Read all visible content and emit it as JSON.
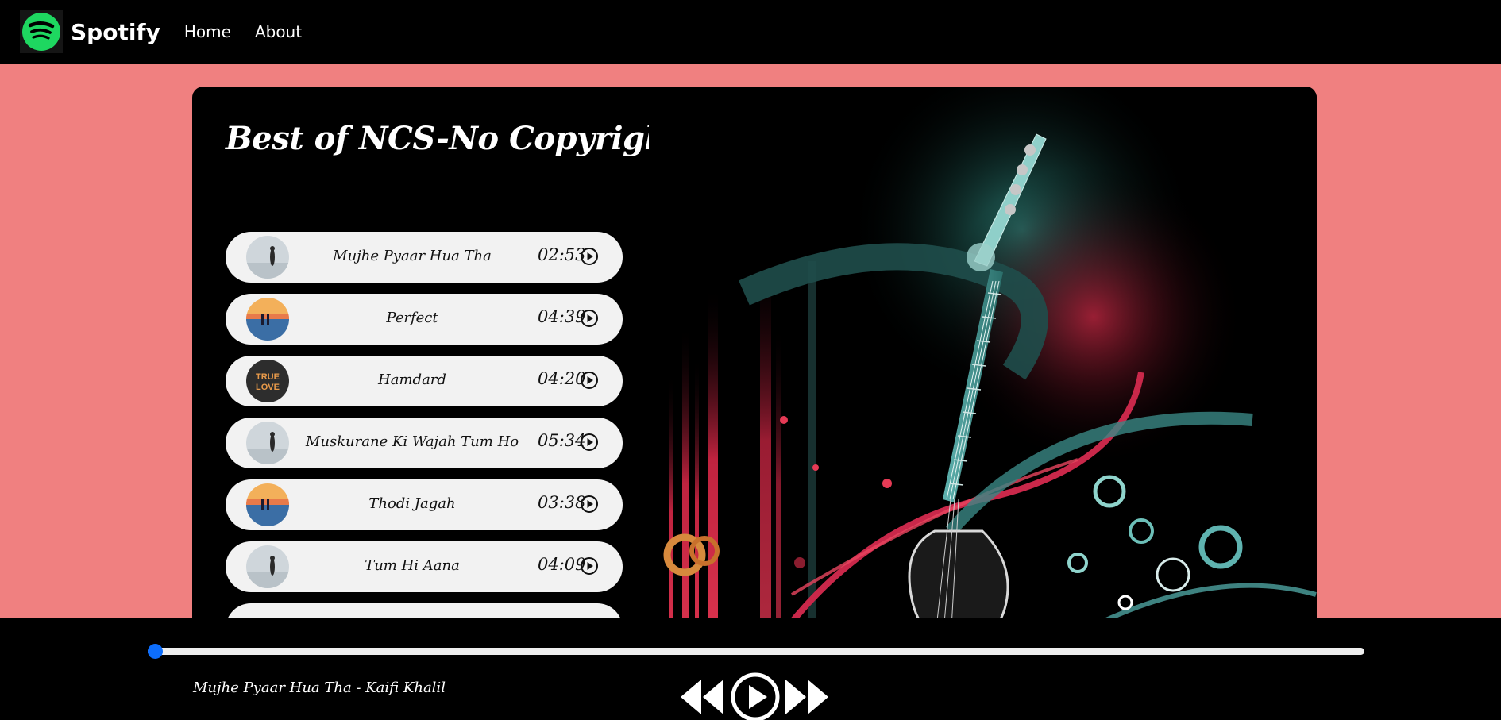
{
  "nav": {
    "brand": "Spotify",
    "links": [
      "Home",
      "About"
    ]
  },
  "playlist": {
    "title": "Best of NCS-No Copyright Sounds",
    "songs": [
      {
        "name": "Mujhe Pyaar Hua Tha",
        "duration": "02:53",
        "thumb": "sea-girl"
      },
      {
        "name": "Perfect",
        "duration": "04:39",
        "thumb": "sunset-couple"
      },
      {
        "name": "Hamdard",
        "duration": "04:20",
        "thumb": "true-love"
      },
      {
        "name": "Muskurane Ki Wajah Tum Ho",
        "duration": "05:34",
        "thumb": "sea-girl"
      },
      {
        "name": "Thodi Jagah",
        "duration": "03:38",
        "thumb": "sunset-couple"
      },
      {
        "name": "Tum Hi Aana",
        "duration": "04:09",
        "thumb": "sea-girl"
      }
    ]
  },
  "player": {
    "now_playing": "Mujhe Pyaar Hua Tha - Kaifi Khalil",
    "progress": 0
  },
  "colors": {
    "page_bg": "#f08080",
    "accent_blue": "#0d6efd",
    "spotify_green": "#1ed760"
  },
  "icons": {
    "logo": "spotify-logo-icon",
    "song_play": "play-circle-icon",
    "prev": "previous-track-icon",
    "play": "play-circle-icon",
    "next": "next-track-icon"
  }
}
